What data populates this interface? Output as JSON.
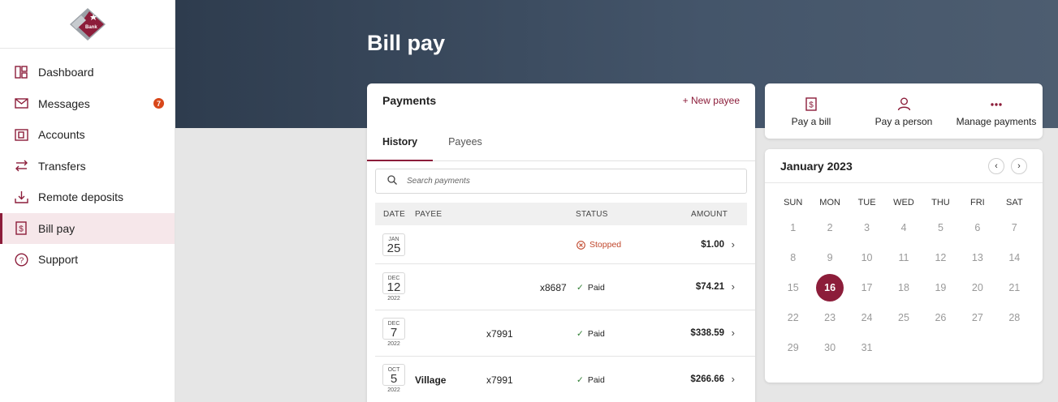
{
  "brand": {
    "accent": "#8c1d3a",
    "logo_text": "Bank"
  },
  "page_title": "Bill pay",
  "sidebar": {
    "items": [
      {
        "label": "Dashboard",
        "icon": "dashboard-icon"
      },
      {
        "label": "Messages",
        "icon": "envelope-icon",
        "badge": "7"
      },
      {
        "label": "Accounts",
        "icon": "wallet-icon"
      },
      {
        "label": "Transfers",
        "icon": "transfer-icon"
      },
      {
        "label": "Remote deposits",
        "icon": "download-icon"
      },
      {
        "label": "Bill pay",
        "icon": "bill-icon",
        "active": true
      },
      {
        "label": "Support",
        "icon": "help-icon"
      }
    ]
  },
  "payments": {
    "title": "Payments",
    "new_payee": "+ New payee",
    "tabs": [
      "History",
      "Payees"
    ],
    "search_placeholder": "Search payments",
    "columns": [
      "DATE",
      "PAYEE",
      "STATUS",
      "AMOUNT"
    ],
    "rows": [
      {
        "month": "JAN",
        "day": "25",
        "year": "",
        "payee": "",
        "account": "",
        "status": "Stopped",
        "amount": "$1.00"
      },
      {
        "month": "DEC",
        "day": "12",
        "year": "2022",
        "payee": "",
        "account": "x8687",
        "status": "Paid",
        "amount": "$74.21"
      },
      {
        "month": "DEC",
        "day": "7",
        "year": "2022",
        "payee": "",
        "account": "x7991",
        "status": "Paid",
        "amount": "$338.59"
      },
      {
        "month": "OCT",
        "day": "5",
        "year": "2022",
        "payee": "Village",
        "account": "x7991",
        "status": "Paid",
        "amount": "$266.66"
      }
    ]
  },
  "actions": [
    {
      "label": "Pay a bill",
      "icon": "bill-icon"
    },
    {
      "label": "Pay a person",
      "icon": "person-icon"
    },
    {
      "label": "Manage payments",
      "icon": "more-icon"
    }
  ],
  "calendar": {
    "title": "January 2023",
    "weekdays": [
      "SUN",
      "MON",
      "TUE",
      "WED",
      "THU",
      "FRI",
      "SAT"
    ],
    "days": [
      "1",
      "2",
      "3",
      "4",
      "5",
      "6",
      "7",
      "8",
      "9",
      "10",
      "11",
      "12",
      "13",
      "14",
      "15",
      "16",
      "17",
      "18",
      "19",
      "20",
      "21",
      "22",
      "23",
      "24",
      "25",
      "26",
      "27",
      "28",
      "29",
      "30",
      "31"
    ],
    "selected": "16"
  }
}
